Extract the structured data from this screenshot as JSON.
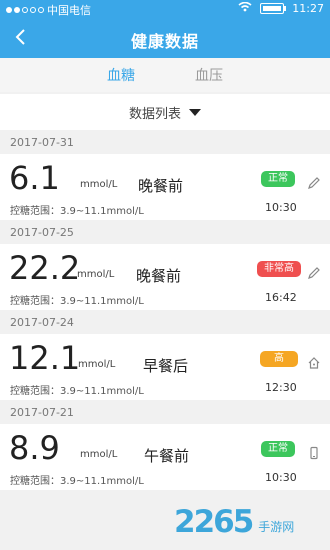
{
  "status": {
    "carrier": "中国电信",
    "time": "11:27"
  },
  "nav": {
    "title": "健康数据"
  },
  "tabs": [
    {
      "label": "血糖",
      "active": true
    },
    {
      "label": "血压",
      "active": false
    }
  ],
  "list": {
    "header": "数据列表"
  },
  "entries": [
    {
      "date": "2017-07-31",
      "value": "6.1",
      "unit": "mmol/L",
      "meal": "晚餐前",
      "range": "控糖范围：3.9~11.1mmol/L",
      "badge": "正常",
      "badge_color": "#3cc65c",
      "time": "10:30",
      "icon": "edit-icon"
    },
    {
      "date": "2017-07-25",
      "value": "22.2",
      "unit": "mmol/L",
      "meal": "晚餐前",
      "range": "控糖范围：3.9~11.1mmol/L",
      "badge": "非常高",
      "badge_color": "#ef4f4f",
      "time": "16:42",
      "icon": "edit-icon"
    },
    {
      "date": "2017-07-24",
      "value": "12.1",
      "unit": "mmol/L",
      "meal": "早餐后",
      "range": "控糖范围：3.9~11.1mmol/L",
      "badge": "高",
      "badge_color": "#f5a623",
      "time": "12:30",
      "icon": "home-icon"
    },
    {
      "date": "2017-07-21",
      "value": "8.9",
      "unit": "mmol/L",
      "meal": "午餐前",
      "range": "控糖范围：3.9~11.1mmol/L",
      "badge": "正常",
      "badge_color": "#3cc65c",
      "time": "10:30",
      "icon": "phone-icon"
    }
  ],
  "watermark": {
    "brand": "2265",
    "tag": "手游网"
  }
}
